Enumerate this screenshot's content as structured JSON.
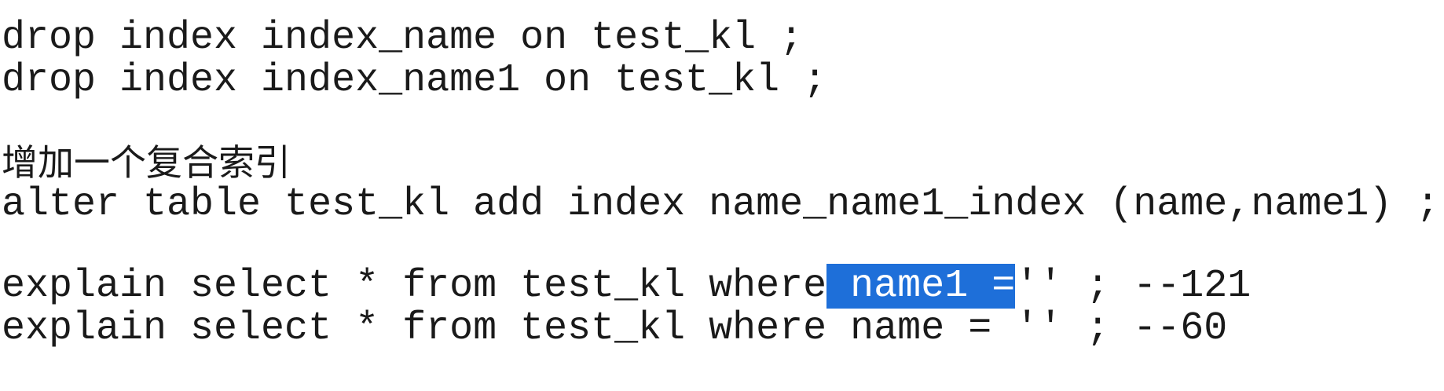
{
  "lines": {
    "drop1": "drop index index_name on test_kl ;",
    "drop2": "drop index index_name1 on test_kl ;",
    "comment": "增加一个复合索引",
    "alter": "alter table test_kl add index name_name1_index (name,name1) ;",
    "explain1": {
      "before": "explain select * from test_kl where",
      "selected": " name1 =",
      "after": "'' ; --121"
    },
    "explain2": "explain select * from test_kl where name = '' ; --60"
  },
  "colors": {
    "text": "#1a1a1a",
    "selection": "#1e6fd9",
    "background": "#ffffff"
  }
}
